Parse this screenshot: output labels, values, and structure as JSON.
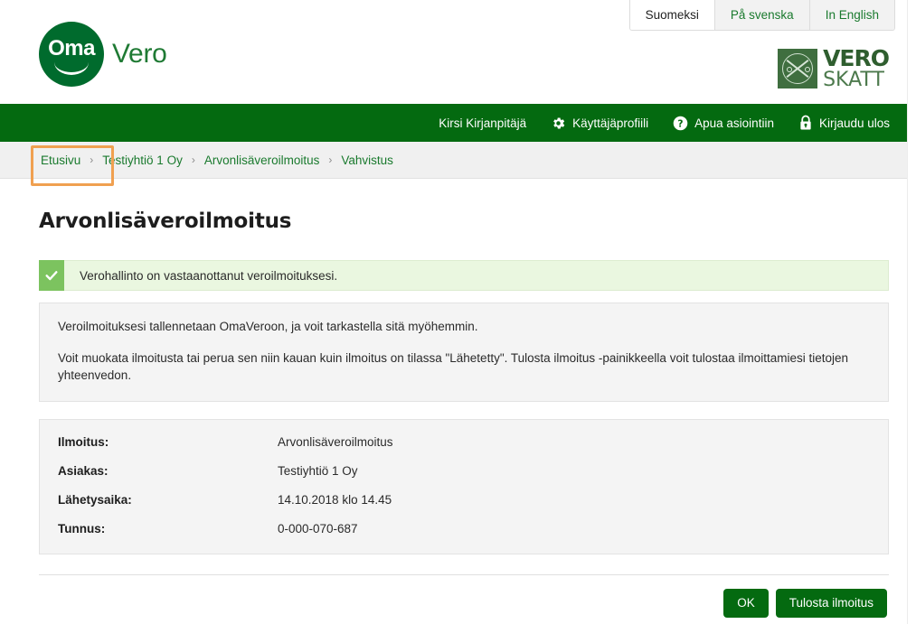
{
  "header": {
    "logo": {
      "badge_text": "Oma",
      "word": "Vero",
      "icon": "oma-vero-logo"
    },
    "brand_right": {
      "line1": "VERO",
      "line2": "SKATT",
      "icon": "vero-skatt-emblem"
    },
    "language_tabs": [
      {
        "label": "Suomeksi",
        "active": true
      },
      {
        "label": "På svenska",
        "active": false
      },
      {
        "label": "In English",
        "active": false
      }
    ]
  },
  "navbar": {
    "items": [
      {
        "label": "Kirsi Kirjanpitäjä",
        "icon": null
      },
      {
        "label": "Käyttäjäprofiili",
        "icon": "gear-icon"
      },
      {
        "label": "Apua asiointiin",
        "icon": "help-circle-icon"
      },
      {
        "label": "Kirjaudu ulos",
        "icon": "lock-icon"
      }
    ]
  },
  "breadcrumb": {
    "items": [
      {
        "label": "Etusivu",
        "highlighted": true
      },
      {
        "label": "Testiyhtiö 1 Oy",
        "highlighted": false
      },
      {
        "label": "Arvonlisäveroilmoitus",
        "highlighted": false
      },
      {
        "label": "Vahvistus",
        "highlighted": false
      }
    ],
    "separator": "›"
  },
  "main": {
    "title": "Arvonlisäveroilmoitus",
    "alert": {
      "icon": "check-icon",
      "text": "Verohallinto on vastaanottanut veroilmoituksesi."
    },
    "info_paragraphs": [
      "Veroilmoituksesi tallennetaan OmaVeroon, ja voit tarkastella sitä myöhemmin.",
      "Voit muokata ilmoitusta tai perua sen niin kauan kuin ilmoitus on tilassa \"Lähetetty\". Tulosta ilmoitus -painikkeella voit tulostaa ilmoittamiesi tietojen yhteenvedon."
    ],
    "details": [
      {
        "label": "Ilmoitus:",
        "value": "Arvonlisäveroilmoitus"
      },
      {
        "label": "Asiakas:",
        "value": "Testiyhtiö 1 Oy"
      },
      {
        "label": "Lähetysaika:",
        "value": "14.10.2018 klo 14.45"
      },
      {
        "label": "Tunnus:",
        "value": "0-000-070-687"
      }
    ],
    "buttons": [
      {
        "label": "OK",
        "name": "ok-button"
      },
      {
        "label": "Tulosta ilmoitus",
        "name": "print-report-button"
      }
    ]
  },
  "colors": {
    "brand_green": "#046a10",
    "logo_green": "#006b2d",
    "link_green": "#1a7a2e",
    "highlight_orange": "#f0a050",
    "alert_bg": "#eaf7e0",
    "alert_icon_bg": "#7cc35f",
    "panel_bg": "#f4f4f4"
  }
}
